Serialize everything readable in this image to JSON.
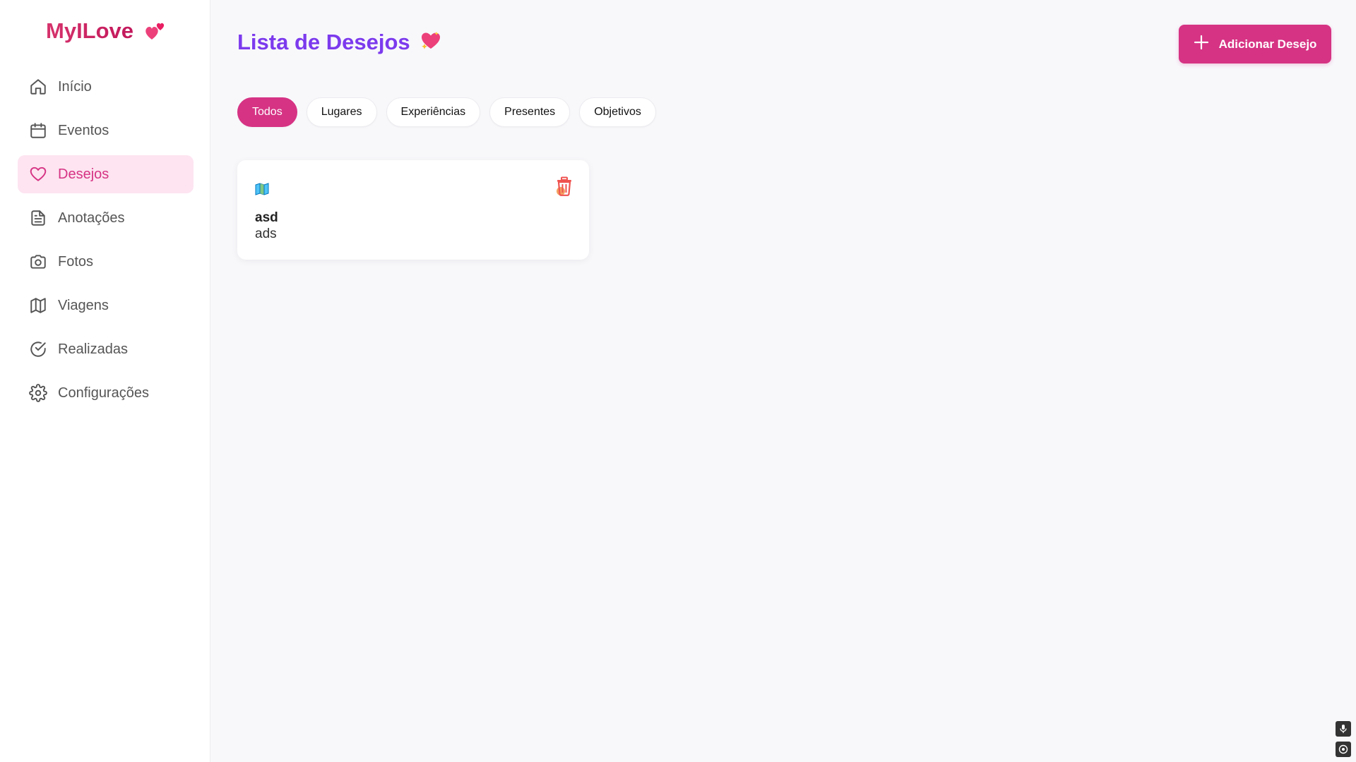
{
  "brand": {
    "name": "MyILove",
    "icon": "two-hearts-icon"
  },
  "sidebar": {
    "items": [
      {
        "label": "Início",
        "icon": "home-icon",
        "active": false
      },
      {
        "label": "Eventos",
        "icon": "calendar-icon",
        "active": false
      },
      {
        "label": "Desejos",
        "icon": "heart-icon",
        "active": true
      },
      {
        "label": "Anotações",
        "icon": "document-icon",
        "active": false
      },
      {
        "label": "Fotos",
        "icon": "camera-icon",
        "active": false
      },
      {
        "label": "Viagens",
        "icon": "map-icon",
        "active": false
      },
      {
        "label": "Realizadas",
        "icon": "check-circle-icon",
        "active": false
      },
      {
        "label": "Configurações",
        "icon": "gear-icon",
        "active": false
      }
    ]
  },
  "header": {
    "title": "Lista de Desejos",
    "title_icon": "sparkling-heart-icon",
    "add_button_label": "Adicionar Desejo"
  },
  "filters": [
    {
      "label": "Todos",
      "active": true
    },
    {
      "label": "Lugares",
      "active": false
    },
    {
      "label": "Experiências",
      "active": false
    },
    {
      "label": "Presentes",
      "active": false
    },
    {
      "label": "Objetivos",
      "active": false
    }
  ],
  "wishes": [
    {
      "category_icon": "map-icon",
      "title": "asd",
      "description": "ads"
    }
  ],
  "colors": {
    "accent": "#d63384",
    "title": "#7c3aed",
    "active_bg": "#fde4f0"
  }
}
